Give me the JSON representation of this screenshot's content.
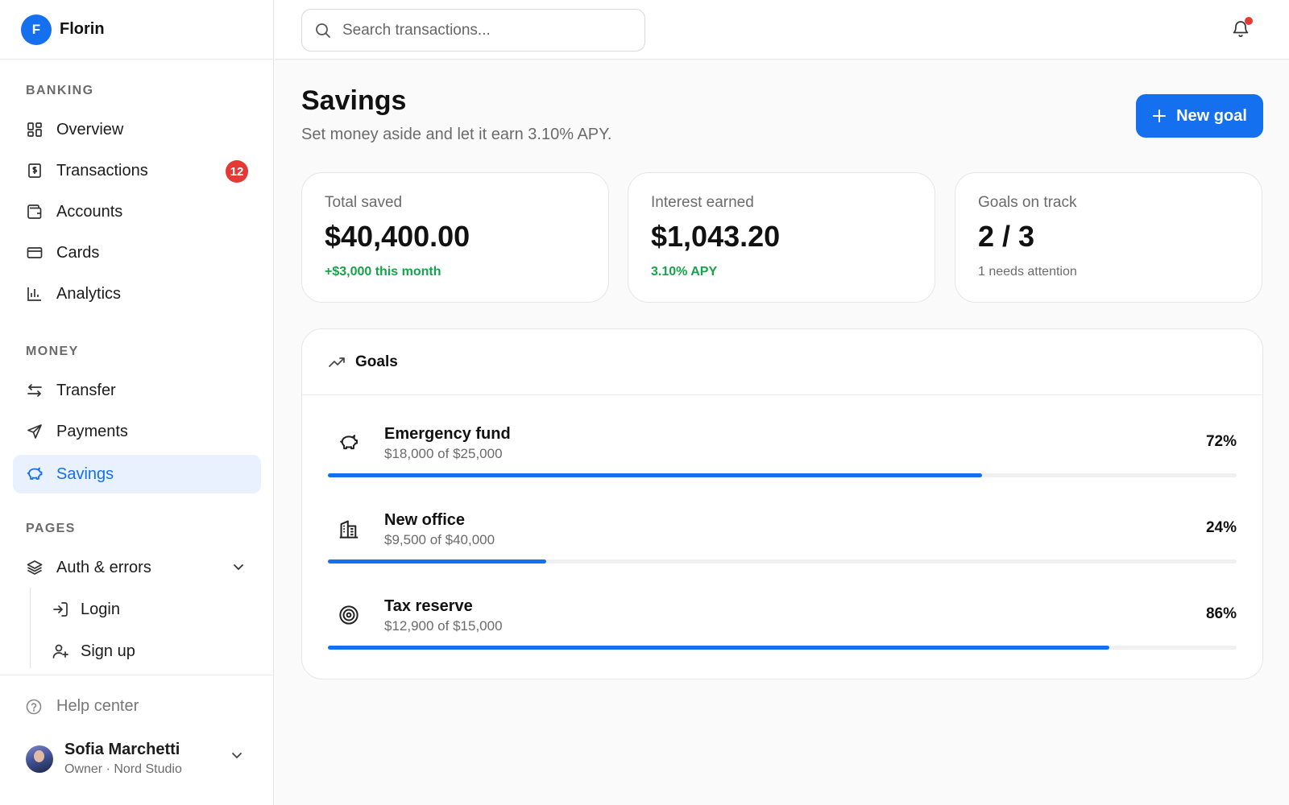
{
  "brand": {
    "initial": "F",
    "name": "Florin"
  },
  "sidebar": {
    "sections": [
      {
        "label": "BANKING"
      },
      {
        "label": "MONEY"
      },
      {
        "label": "PAGES"
      }
    ],
    "banking": [
      {
        "label": "Overview",
        "icon": "grid-icon"
      },
      {
        "label": "Transactions",
        "icon": "receipt-icon",
        "badge": "12"
      },
      {
        "label": "Accounts",
        "icon": "wallet-icon"
      },
      {
        "label": "Cards",
        "icon": "card-icon"
      },
      {
        "label": "Analytics",
        "icon": "bar-chart-icon"
      }
    ],
    "money": [
      {
        "label": "Transfer",
        "icon": "arrows-icon"
      },
      {
        "label": "Payments",
        "icon": "send-icon"
      },
      {
        "label": "Savings",
        "icon": "piggy-bank-icon",
        "active": true
      }
    ],
    "pages": {
      "label": "Auth & errors",
      "icon": "layers-icon",
      "children": [
        {
          "label": "Login",
          "icon": "login-icon"
        },
        {
          "label": "Sign up",
          "icon": "user-plus-icon"
        }
      ]
    },
    "help": "Help center",
    "user": {
      "name": "Sofia Marchetti",
      "role": "Owner · Nord Studio"
    }
  },
  "topbar": {
    "search_placeholder": "Search transactions..."
  },
  "page": {
    "title": "Savings",
    "subtitle": "Set money aside and let it earn 3.10% APY.",
    "new_goal_label": "New goal"
  },
  "stats": [
    {
      "label": "Total saved",
      "value": "$40,400.00",
      "note": "+$3,000 this month"
    },
    {
      "label": "Interest earned",
      "value": "$1,043.20",
      "note": "3.10% APY"
    },
    {
      "label": "Goals on track",
      "value": "2 / 3",
      "note": "1 needs attention"
    }
  ],
  "goals": {
    "title": "Goals",
    "items": [
      {
        "name": "Emergency fund",
        "amount": "$18,000 of $25,000",
        "pct_label": "72%",
        "progress": 0.72,
        "icon": "piggy-bank-icon"
      },
      {
        "name": "New office",
        "amount": "$9,500 of $40,000",
        "pct_label": "24%",
        "progress": 0.24,
        "icon": "building-icon"
      },
      {
        "name": "Tax reserve",
        "amount": "$12,900 of $15,000",
        "pct_label": "86%",
        "progress": 0.86,
        "icon": "target-icon"
      }
    ]
  },
  "colors": {
    "accent": "#1570ef",
    "positive": "#16a34a",
    "badge": "#e53935"
  }
}
